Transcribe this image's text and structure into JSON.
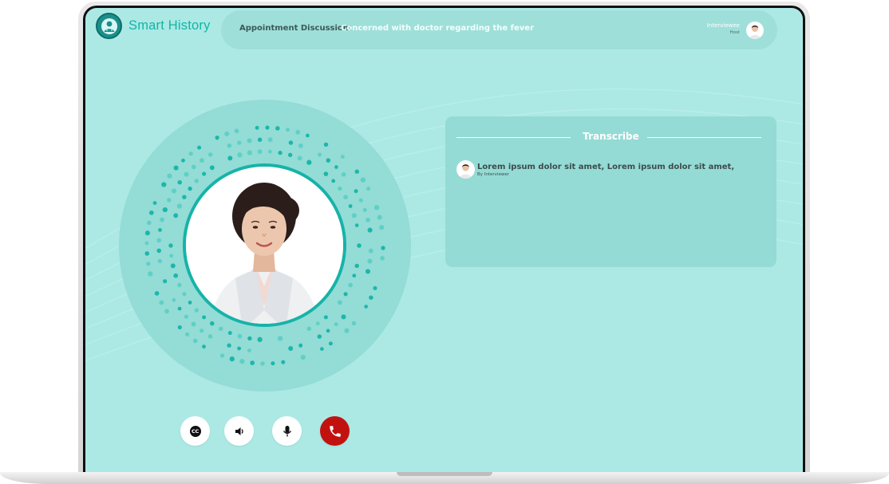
{
  "app": {
    "name": "Smart History"
  },
  "header": {
    "appointment_label": "Appointment Discussion:",
    "appointment_value": "Concerned with doctor regarding the fever",
    "role_title": "Interviewee",
    "role_subtitle": "Host"
  },
  "transcript": {
    "title": "Transcribe",
    "messages": [
      {
        "text": "Lorem ipsum dolor sit amet, Lorem ipsum dolor sit amet,",
        "by": "By Interviewer"
      }
    ]
  },
  "controls": [
    {
      "name": "closed-captions",
      "icon": "cc-icon"
    },
    {
      "name": "speaker",
      "icon": "speaker-icon"
    },
    {
      "name": "microphone",
      "icon": "microphone-icon"
    },
    {
      "name": "end-call",
      "icon": "phone-hangup-icon"
    }
  ],
  "colors": {
    "screen_bg": "#ace9e5",
    "brand": "#13b5a7",
    "accent_ring": "#16b3a8",
    "end_call": "#c2120f"
  }
}
